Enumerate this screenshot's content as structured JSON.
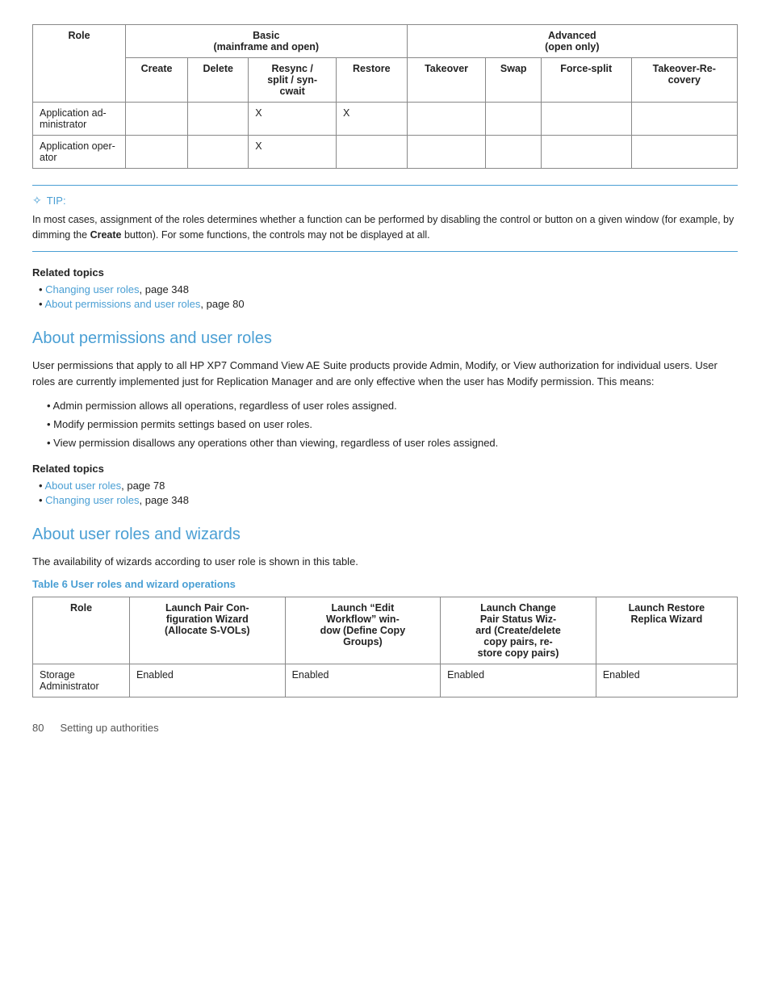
{
  "top_table": {
    "group_headers": [
      {
        "label": "Basic\n(mainframe and open)",
        "colspan": 4
      },
      {
        "label": "Advanced\n(open only)",
        "colspan": 4
      }
    ],
    "role_label": "Role",
    "col_headers": [
      "Create",
      "Delete",
      "Resync /\nsplit / syn-\ncwait",
      "Restore",
      "Takeover",
      "Swap",
      "Force-split",
      "Takeover-Re-\ncovery"
    ],
    "rows": [
      {
        "role": "Application ad-\nministrator",
        "create": "",
        "delete": "",
        "resync": "X",
        "restore": "X",
        "takeover": "",
        "swap": "",
        "force_split": "",
        "takeover_re": ""
      },
      {
        "role": "Application oper-\nator",
        "create": "",
        "delete": "",
        "resync": "X",
        "restore": "",
        "takeover": "",
        "swap": "",
        "force_split": "",
        "takeover_re": ""
      }
    ]
  },
  "tip": {
    "label": "TIP:",
    "text": "In most cases, assignment of the roles determines whether a function can be performed by disabling the control or button on a given window (for example, by dimming the Create button). For some functions, the controls may not be displayed at all."
  },
  "related_topics_1": {
    "title": "Related topics",
    "items": [
      {
        "link": "Changing user roles",
        "suffix": ", page 348"
      },
      {
        "link": "About permissions and user roles",
        "suffix": ", page 80"
      }
    ]
  },
  "section_about_permissions": {
    "heading": "About permissions and user roles",
    "body": "User permissions that apply to all HP XP7 Command View AE Suite products provide Admin, Modify, or View authorization for individual users. User roles are currently implemented just for Replication Manager and are only effective when the user has Modify permission. This means:",
    "bullets": [
      "Admin permission allows all operations, regardless of user roles assigned.",
      "Modify permission permits settings based on user roles.",
      "View permission disallows any operations other than viewing, regardless of user roles assigned."
    ],
    "related_topics": {
      "title": "Related topics",
      "items": [
        {
          "link": "About user roles",
          "suffix": ", page 78"
        },
        {
          "link": "Changing user roles",
          "suffix": ", page 348"
        }
      ]
    }
  },
  "section_about_wizards": {
    "heading": "About user roles and wizards",
    "intro": "The availability of wizards according to user role is shown in this table.",
    "table_caption": "Table 6 User roles and wizard operations",
    "table": {
      "col_headers": [
        "Role",
        "Launch Pair Con-\nfiguration Wizard\n(Allocate S-VOLs)",
        "Launch \"Edit\nWorkflow\" win-\ndow (Define Copy\nGroups)",
        "Launch Change\nPair Status Wiz-\nard (Create/delete\ncopy pairs, re-\nstore copy pairs)",
        "Launch Restore\nReplica Wizard"
      ],
      "rows": [
        {
          "role": "Storage\nAdministrator",
          "col1": "Enabled",
          "col2": "Enabled",
          "col3": "Enabled",
          "col4": "Enabled"
        }
      ]
    }
  },
  "footer": {
    "page_number": "80",
    "text": "Setting up authorities"
  }
}
